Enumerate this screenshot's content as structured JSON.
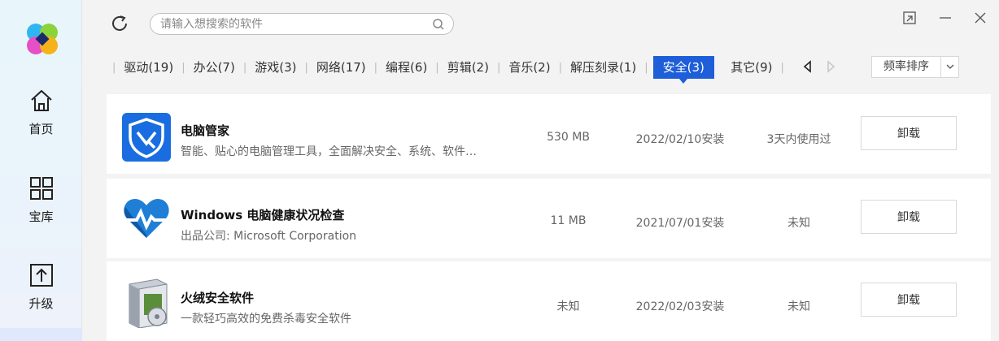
{
  "sidebar": {
    "items": [
      {
        "label": "首页",
        "icon": "home-icon"
      },
      {
        "label": "宝库",
        "icon": "grid-icon"
      },
      {
        "label": "升级",
        "icon": "upgrade-icon"
      }
    ]
  },
  "search": {
    "placeholder": "请输入想搜索的软件"
  },
  "tabs": [
    {
      "label": "驱动(19)"
    },
    {
      "label": "办公(7)"
    },
    {
      "label": "游戏(3)"
    },
    {
      "label": "网络(17)"
    },
    {
      "label": "编程(6)"
    },
    {
      "label": "剪辑(2)"
    },
    {
      "label": "音乐(2)"
    },
    {
      "label": "解压刻录(1)"
    },
    {
      "label": "安全(3)",
      "active": true
    },
    {
      "label": "其它(9)"
    }
  ],
  "sort": {
    "label": "频率排序"
  },
  "apps": [
    {
      "name": "电脑管家",
      "desc": "智能、贴心的电脑管理工具，全面解决安全、系统、软件…",
      "size": "530 MB",
      "date": "2022/02/10安装",
      "usage": "3天内使用过",
      "action": "卸载",
      "icon": "tencent-pc-manager-icon"
    },
    {
      "name": "Windows 电脑健康状况检查",
      "desc": "出品公司: Microsoft Corporation",
      "size": "11 MB",
      "date": "2021/07/01安装",
      "usage": "未知",
      "action": "卸载",
      "icon": "health-heart-icon"
    },
    {
      "name": "火绒安全软件",
      "desc": "一款轻巧高效的免费杀毒安全软件",
      "size": "未知",
      "date": "2022/02/03安装",
      "usage": "未知",
      "action": "卸载",
      "icon": "software-box-icon"
    }
  ],
  "colors": {
    "accent": "#1e5fd9",
    "sidebar_bg": "#e8f6fb",
    "content_bg": "#f3f3f3"
  }
}
